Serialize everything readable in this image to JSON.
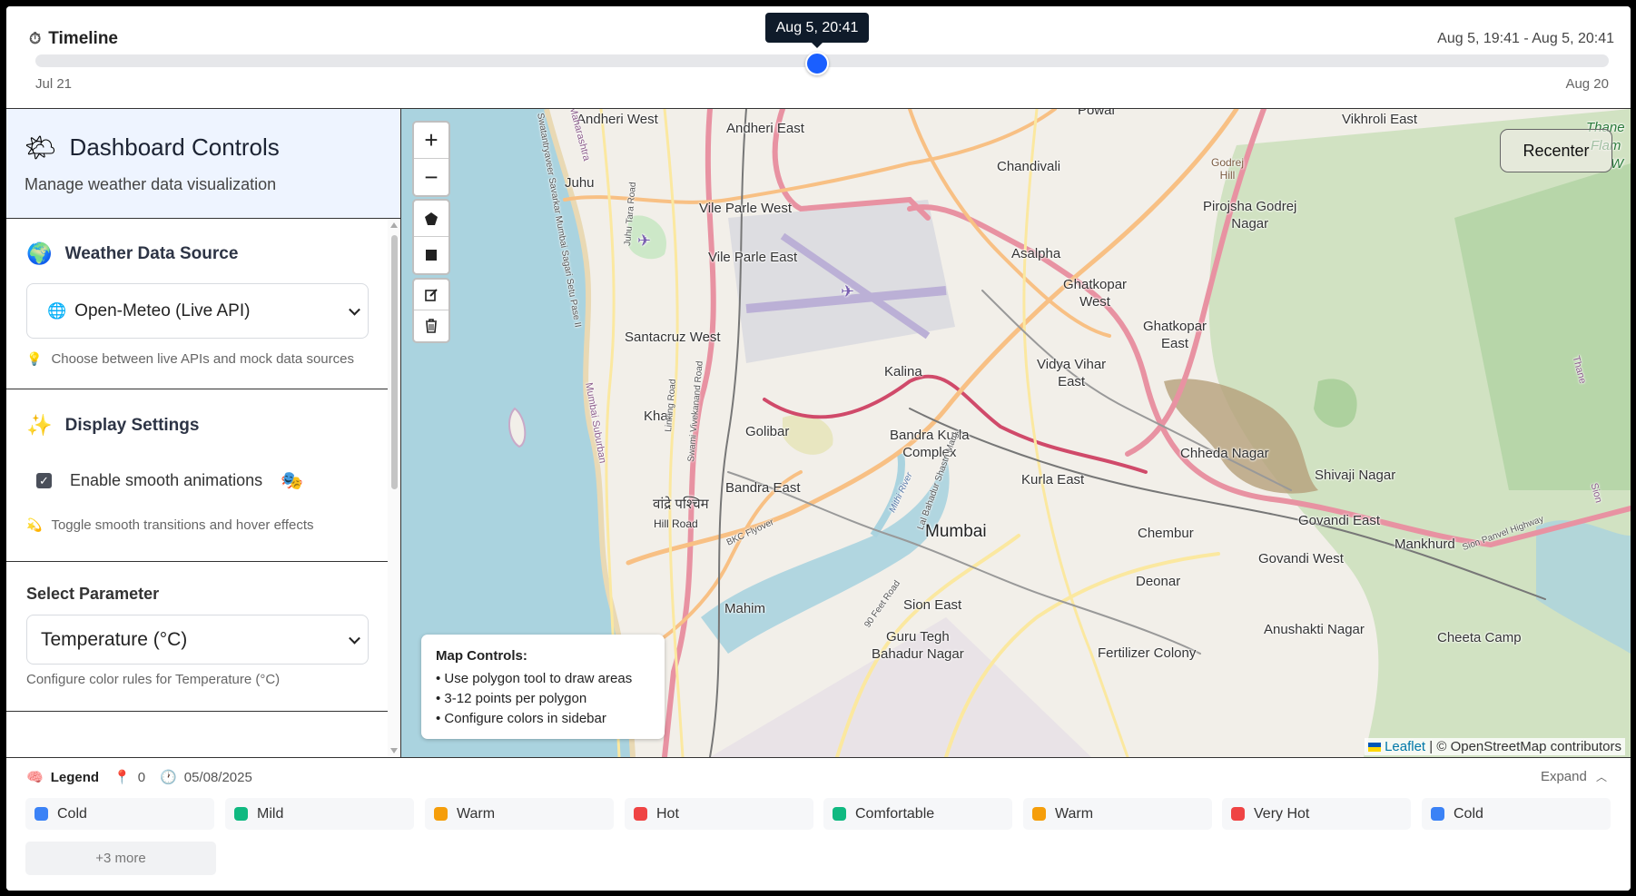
{
  "timeline": {
    "title": "Timeline",
    "range": "Aug 5, 19:41 - Aug 5, 20:41",
    "current": "Aug 5, 20:41",
    "start": "Jul 21",
    "end": "Aug 20",
    "progress": 0.5
  },
  "sidebar": {
    "title": "Dashboard Controls",
    "subtitle": "Manage weather data visualization",
    "data_source": {
      "title": "Weather Data Source",
      "selected": "Open-Meteo (Live API)",
      "hint": "Choose between live APIs and mock data sources"
    },
    "display": {
      "title": "Display Settings",
      "checkbox_label": "Enable smooth animations",
      "checked": true,
      "hint": "Toggle smooth transitions and hover effects"
    },
    "parameter": {
      "title": "Select Parameter",
      "selected": "Temperature (°C)",
      "hint": "Configure color rules for Temperature (°C)"
    }
  },
  "map": {
    "zoom_in": "+",
    "zoom_out": "−",
    "recenter": "Recenter",
    "info": {
      "title": "Map Controls:",
      "lines": [
        "• Use polygon tool to draw areas",
        "• 3-12 points per polygon",
        "• Configure colors in sidebar"
      ]
    },
    "attribution_link": "Leaflet",
    "attribution_text": "| © OpenStreetMap contributors",
    "labels": {
      "andheri_west": "Andheri West",
      "andheri_east": "Andheri East",
      "powai": "Powai",
      "vikhroli_east": "Vikhroli East",
      "thane": "Thane",
      "flam": "Flam",
      "w": "W",
      "juhu": "Juhu",
      "vile_parle_west": "Vile Parle West",
      "chandivali": "Chandivali",
      "godrej_hill_1": "Godrej",
      "godrej_hill_2": "Hill",
      "pirojsha_1": "Pirojsha Godrej",
      "pirojsha_2": "Nagar",
      "vile_parle_east": "Vile Parle East",
      "asalpha": "Asalpha",
      "ghatkopar_west_1": "Ghatkopar",
      "ghatkopar_west_2": "West",
      "santacruz_west": "Santacruz West",
      "ghatkopar_east_1": "Ghatkopar",
      "ghatkopar_east_2": "East",
      "kalina": "Kalina",
      "vidya_vihar_1": "Vidya Vihar",
      "vidya_vihar_2": "East",
      "khar": "Khar",
      "golibar": "Golibar",
      "bkc_1": "Bandra Kurla",
      "bkc_2": "Complex",
      "chheda_nagar": "Chheda Nagar",
      "shivaji_nagar": "Shivaji Nagar",
      "bandra_east": "Bandra East",
      "kurla_east": "Kurla East",
      "vandre_paschim": "वांद्रे पश्चिम",
      "hill_road": "Hill Road",
      "mumbai": "Mumbai",
      "chembur": "Chembur",
      "govandi_east": "Govandi East",
      "govandi_west": "Govandi West",
      "mankhurd": "Mankhurd",
      "deonar": "Deonar",
      "mahim": "Mahim",
      "sion_east": "Sion East",
      "guru_tegh_1": "Guru Tegh",
      "guru_tegh_2": "Bahadur Nagar",
      "fertilizer_colony": "Fertilizer Colony",
      "anushakti_nagar": "Anushakti Nagar",
      "cheeta_camp": "Cheeta Camp",
      "maharashtra": "Maharashtra",
      "sea_link_road": "Swatantryaveer Savarkar Mumbai Sagari Setu Pase II",
      "juhu_tara_road": "Juhu Tara Road",
      "linking_road": "Linking Road",
      "swami_vivekanand_road": "Swami Vivekanand Road",
      "mithi_river": "Mithi River",
      "lbs_marg": "Lal Bahadur Shastri Marg",
      "mumbai_suburban": "Mumbai Suburban",
      "bkc_flyover": "BKC Flyover",
      "feet_road": "90 Feet Road",
      "sion_panvel": "Sion Panvel Highway",
      "thane_side": "Thane",
      "sion_side": "Sion"
    }
  },
  "legend": {
    "title": "Legend",
    "pins": "0",
    "date": "05/08/2025",
    "expand": "Expand",
    "items": [
      {
        "label": "Cold",
        "color": "#3b82f6"
      },
      {
        "label": "Mild",
        "color": "#10b981"
      },
      {
        "label": "Warm",
        "color": "#f59e0b"
      },
      {
        "label": "Hot",
        "color": "#ef4444"
      },
      {
        "label": "Comfortable",
        "color": "#10b981"
      },
      {
        "label": "Warm",
        "color": "#f59e0b"
      },
      {
        "label": "Very Hot",
        "color": "#ef4444"
      },
      {
        "label": "Cold",
        "color": "#3b82f6"
      }
    ],
    "more": "+3 more"
  }
}
